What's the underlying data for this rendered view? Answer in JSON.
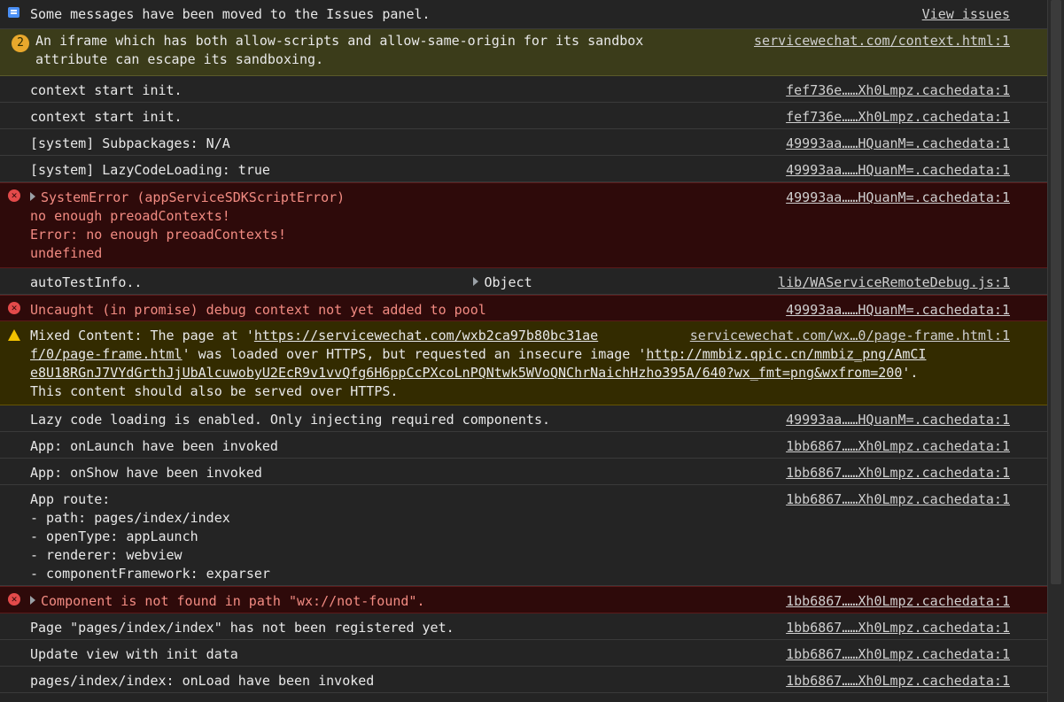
{
  "info": {
    "text": "Some messages have been moved to the Issues panel.",
    "action": "View issues"
  },
  "issue": {
    "count": "2",
    "text1": "An iframe which has both allow-scripts and allow-same-origin for its sandbox",
    "text2": "attribute can escape its sandboxing.",
    "source": "servicewechat.com/context.html:1"
  },
  "rows": [
    {
      "text": "context start init.",
      "source": "fef736e……Xh0Lmpz.cachedata:1"
    },
    {
      "text": "context start init.",
      "source": "fef736e……Xh0Lmpz.cachedata:1"
    },
    {
      "text": "[system] Subpackages: N/A",
      "source": "49993aa……HQuanM=.cachedata:1"
    },
    {
      "text": "[system] LazyCodeLoading: true",
      "source": "49993aa……HQuanM=.cachedata:1"
    }
  ],
  "system_error": {
    "title": "SystemError (appServiceSDKScriptError)",
    "line1": "no enough preoadContexts!",
    "line2": "Error: no enough preoadContexts!",
    "line3": "undefined",
    "source": "49993aa……HQuanM=.cachedata:1"
  },
  "autotest": {
    "text": "autoTestInfo..",
    "object": "Object",
    "source": "lib/WAServiceRemoteDebug.js:1"
  },
  "uncaught": {
    "text": "Uncaught (in promise) debug context not yet added to pool",
    "source": "49993aa……HQuanM=.cachedata:1"
  },
  "mixed": {
    "prefix": "Mixed Content: The page at '",
    "url1a": "https://servicewechat.com/wxb2ca97b80bc31ae",
    "source": "servicewechat.com/wx…0/page-frame.html:1",
    "url1b": "f/0/page-frame.html",
    "mid": "' was loaded over HTTPS, but requested an insecure image '",
    "url2a": "http://mmbiz.qpic.cn/mmbiz_png/AmCI",
    "url2b": "e8U18RGnJ7VYdGrthJjUbAlcuwobyU2EcR9v1vvQfg6H6ppCcPXcoLnPQNtwk5WVoQNChrNaichHzho395A/640?wx_fmt=png&wxfrom=200",
    "end": "'.",
    "line4": "This content should also be served over HTTPS."
  },
  "rows2": [
    {
      "text": "Lazy code loading is enabled. Only injecting required components.",
      "source": "49993aa……HQuanM=.cachedata:1"
    },
    {
      "text": "App: onLaunch have been invoked",
      "source": "1bb6867……Xh0Lmpz.cachedata:1"
    },
    {
      "text": "App: onShow have been invoked",
      "source": "1bb6867……Xh0Lmpz.cachedata:1"
    }
  ],
  "route": {
    "lines": [
      "App route:",
      "- path: pages/index/index",
      "- openType: appLaunch",
      "- renderer: webview",
      "- componentFramework: exparser"
    ],
    "source": "1bb6867……Xh0Lmpz.cachedata:1"
  },
  "component_error": {
    "text": "Component is not found in path \"wx://not-found\".",
    "source": "1bb6867……Xh0Lmpz.cachedata:1"
  },
  "rows3": [
    {
      "text": "Page \"pages/index/index\" has not been registered yet.",
      "source": "1bb6867……Xh0Lmpz.cachedata:1"
    },
    {
      "text": "Update view with init data",
      "source": "1bb6867……Xh0Lmpz.cachedata:1"
    },
    {
      "text": "pages/index/index: onLoad have been invoked",
      "source": "1bb6867……Xh0Lmpz.cachedata:1"
    }
  ]
}
